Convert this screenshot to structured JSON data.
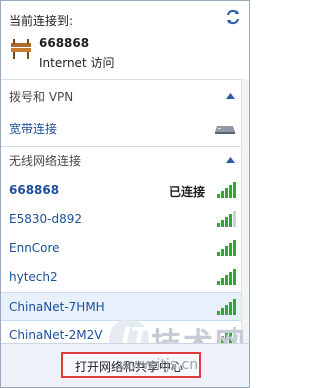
{
  "header": {
    "title": "当前连接到:",
    "network_name": "668868",
    "access_text": "Internet 访问"
  },
  "sections": {
    "dialup": {
      "title": "拨号和 VPN"
    },
    "wireless": {
      "title": "无线网络连接"
    }
  },
  "dialup_items": [
    {
      "label": "宽带连接"
    }
  ],
  "wireless_networks": [
    {
      "name": "668868",
      "status": "已连接",
      "signal": 5
    },
    {
      "name": "E5830-d892",
      "status": "",
      "signal": 4
    },
    {
      "name": "EnnCore",
      "status": "",
      "signal": 5
    },
    {
      "name": "hytech2",
      "status": "",
      "signal": 5
    },
    {
      "name": "ChinaNet-7HMH",
      "status": "",
      "signal": 5
    },
    {
      "name": "ChinaNet-2M2V",
      "status": "",
      "signal": 4
    }
  ],
  "footer": {
    "open_label": "打开网络和共享中心"
  },
  "watermark": {
    "logo_char": "IT",
    "big_text": "技术网",
    "url": "www.itjs.cn"
  },
  "colors": {
    "link": "#1c4f9c",
    "highlight": "#e7f0fb",
    "signal": "#2fa82f",
    "button_border": "#e03a3a"
  }
}
